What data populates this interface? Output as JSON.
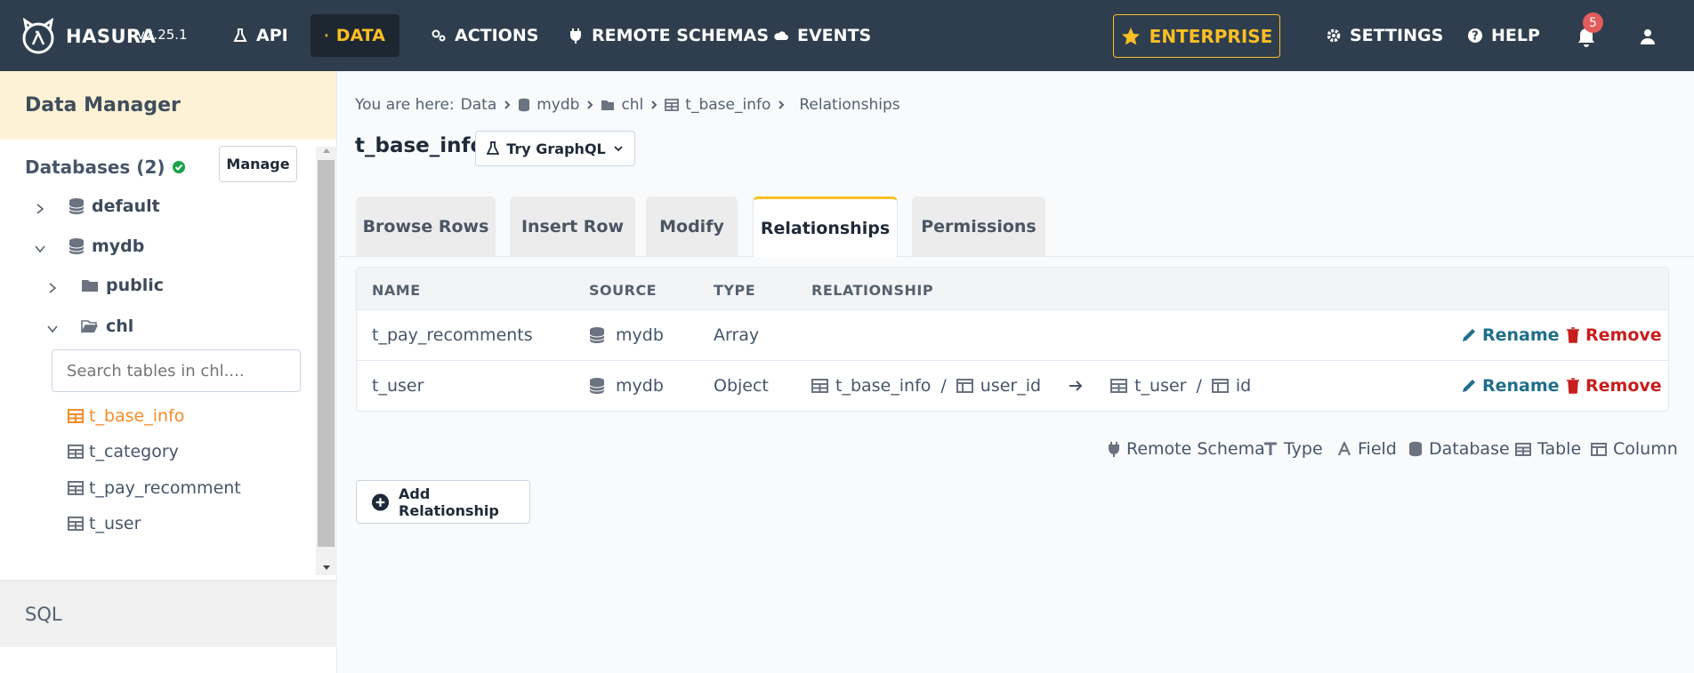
{
  "brand": {
    "logo_text": "HASURA",
    "version": "v2.25.1"
  },
  "nav": {
    "api": "API",
    "data": "DATA",
    "actions": "ACTIONS",
    "remote_schemas": "REMOTE SCHEMAS",
    "events": "EVENTS",
    "enterprise": "ENTERPRISE",
    "settings": "SETTINGS",
    "help": "HELP",
    "notifications_count": "5"
  },
  "colors": {
    "topbar": "#2f3e4e",
    "accent": "#fbbf24",
    "active_table": "#f28c28",
    "rename": "#1f6f8b",
    "remove": "#c81e1e"
  },
  "sidebar": {
    "title": "Data Manager",
    "databases_label": "Databases (2)",
    "manage_label": "Manage",
    "db_default": "default",
    "db_mydb": "mydb",
    "schema_public": "public",
    "schema_chl": "chl",
    "search_placeholder": "Search tables in chl....",
    "tables": [
      "t_base_info",
      "t_category",
      "t_pay_recomment",
      "t_user"
    ],
    "sql_label": "SQL"
  },
  "breadcrumb": {
    "prefix": "You are here:",
    "data": "Data",
    "db": "mydb",
    "schema": "chl",
    "table": "t_base_info",
    "page": "Relationships"
  },
  "page": {
    "title": "t_base_info",
    "try_graphql": "Try GraphQL"
  },
  "tabs": {
    "browse": "Browse Rows",
    "insert": "Insert Row",
    "modify": "Modify",
    "relationships": "Relationships",
    "permissions": "Permissions"
  },
  "table": {
    "headers": {
      "name": "NAME",
      "source": "SOURCE",
      "type": "TYPE",
      "relationship": "RELATIONSHIP"
    },
    "rows": [
      {
        "name": "t_pay_recomments",
        "source": "mydb",
        "type": "Array",
        "from_table": "",
        "from_col": "",
        "to_table": "",
        "to_col": "",
        "rename": "Rename",
        "remove": "Remove"
      },
      {
        "name": "t_user",
        "source": "mydb",
        "type": "Object",
        "from_table": "t_base_info",
        "from_col": "user_id",
        "to_table": "t_user",
        "to_col": "id",
        "rename": "Rename",
        "remove": "Remove",
        "sep": "/"
      }
    ]
  },
  "legend": {
    "remote_schema": "Remote Schema",
    "type": "Type",
    "field": "Field",
    "database": "Database",
    "table": "Table",
    "column": "Column"
  },
  "add_relationship": "Add Relationship"
}
